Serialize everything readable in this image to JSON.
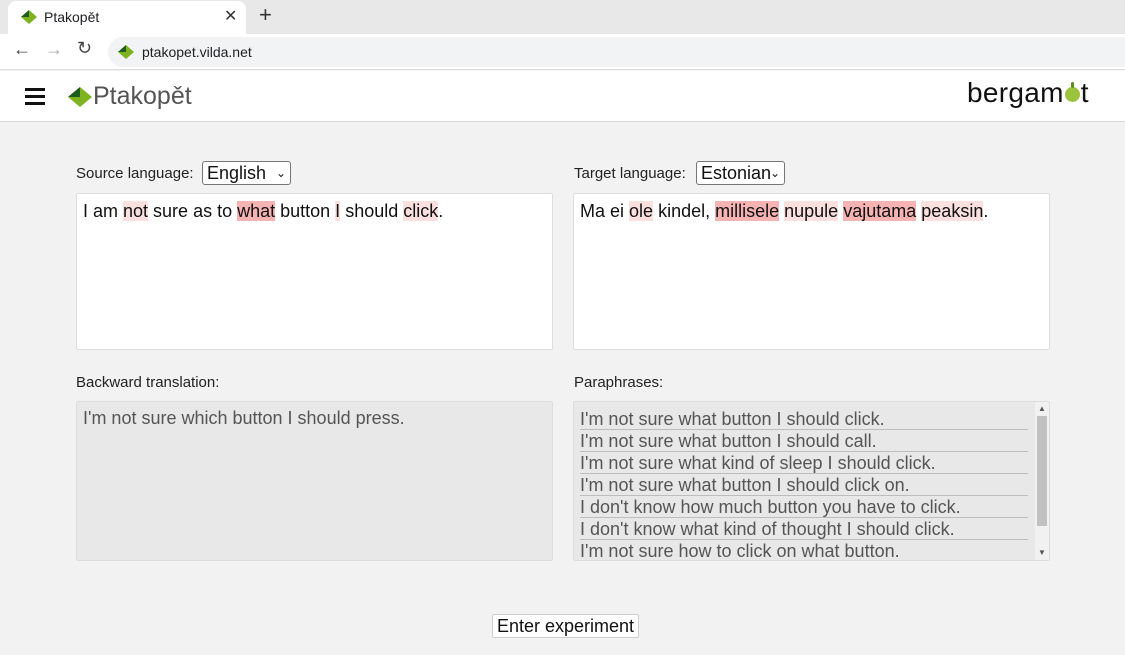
{
  "browser": {
    "tab_title": "Ptakopět",
    "url": "ptakopet.vilda.net"
  },
  "header": {
    "logo_text": "Ptakopět",
    "partner_logo": "bergamot"
  },
  "source": {
    "label": "Source language:",
    "language": "English",
    "tokens": [
      {
        "t": "I am ",
        "h": 0
      },
      {
        "t": "not",
        "h": 1
      },
      {
        "t": " sure as to ",
        "h": 0
      },
      {
        "t": "what",
        "h": 2
      },
      {
        "t": " button ",
        "h": 0
      },
      {
        "t": "I",
        "h": 1
      },
      {
        "t": " should ",
        "h": 0
      },
      {
        "t": "click",
        "h": 1
      },
      {
        "t": ".",
        "h": 0
      }
    ]
  },
  "target": {
    "label": "Target language:",
    "language": "Estonian",
    "tokens": [
      {
        "t": "Ma ei ",
        "h": 0
      },
      {
        "t": "ole",
        "h": 1
      },
      {
        "t": " kindel, ",
        "h": 0
      },
      {
        "t": "millisele",
        "h": 2
      },
      {
        "t": " ",
        "h": 0
      },
      {
        "t": "nupule",
        "h": 1
      },
      {
        "t": " ",
        "h": 0
      },
      {
        "t": "vajutama",
        "h": 2
      },
      {
        "t": " ",
        "h": 0
      },
      {
        "t": "peaksin",
        "h": 1
      },
      {
        "t": ".",
        "h": 0
      }
    ]
  },
  "backward": {
    "label": "Backward translation:",
    "text": "I'm not sure which button I should press."
  },
  "paraphrases": {
    "label": "Paraphrases:",
    "items": [
      "I'm not sure what button I should click.",
      "I'm not sure what button I should call.",
      "I'm not sure what kind of sleep I should click.",
      "I'm not sure what button I should click on.",
      "I don't know how much button you have to click.",
      "I don't know what kind of thought I should click.",
      "I'm not sure how to click on what button."
    ]
  },
  "actions": {
    "enter_experiment": "Enter experiment"
  },
  "colors": {
    "highlight_light": "#fbe0e0",
    "highlight_strong": "#f6b3b3",
    "brand_green": "#9bc33c"
  }
}
